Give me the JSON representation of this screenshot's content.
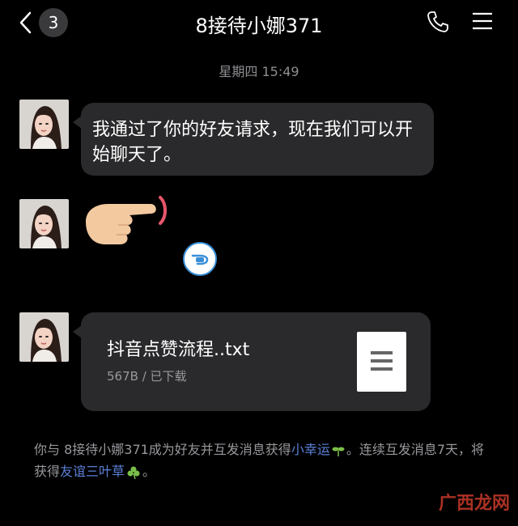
{
  "header": {
    "unread_count": "3",
    "title": "8接待小娜371"
  },
  "timestamp": "星期四 15:49",
  "messages": {
    "text": "我通过了你的好友请求，现在我们可以开始聊天了。",
    "file_name": "抖音点赞流程..txt",
    "file_meta": "567B / 已下载"
  },
  "notice": {
    "part1": "你与 8接待小娜371成为好友并互发消息获得",
    "link1": "小幸运",
    "part2": "。连续互发消息7天，将获得",
    "link2": "友谊三叶草",
    "part3": "。"
  },
  "watermark": "广西龙网"
}
